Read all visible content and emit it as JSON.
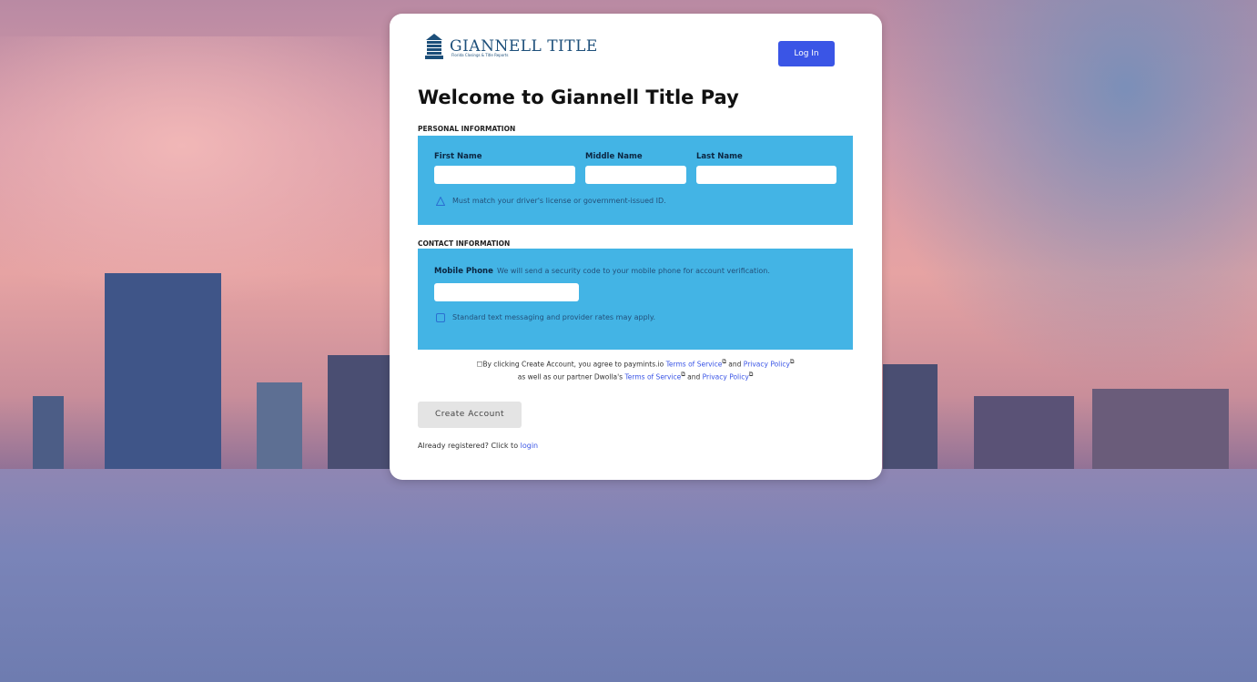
{
  "brand": {
    "name": "GIANNELL TITLE",
    "tagline": "Florida Closings & Title Reports"
  },
  "header": {
    "login_label": "Log In"
  },
  "page": {
    "title": "Welcome to Giannell Title Pay"
  },
  "personal": {
    "section_label": "PERSONAL INFORMATION",
    "first_name_label": "First Name",
    "middle_name_label": "Middle Name",
    "last_name_label": "Last Name",
    "first_name_value": "",
    "middle_name_value": "",
    "last_name_value": "",
    "note": "Must match your driver's license or government-issued ID."
  },
  "contact": {
    "section_label": "CONTACT INFORMATION",
    "mobile_label": "Mobile Phone",
    "mobile_hint": "We will send a security code to your mobile phone for account verification.",
    "mobile_value": "",
    "note": "Standard text messaging and provider rates may apply."
  },
  "terms": {
    "prefix": "By clicking Create Account, you agree to paymints.io",
    "tos1": "Terms of Service",
    "and1": "and",
    "privacy1": "Privacy Policy",
    "middle": "as well as our partner Dwolla's",
    "tos2": "Terms of Service",
    "and2": "and",
    "privacy2": "Privacy Policy"
  },
  "actions": {
    "create_label": "Create Account",
    "already_text": "Already registered? Click to",
    "login_link": "login"
  },
  "colors": {
    "accent": "#3a55e6",
    "panel": "#43b4e5",
    "brand": "#1d4f7a"
  }
}
